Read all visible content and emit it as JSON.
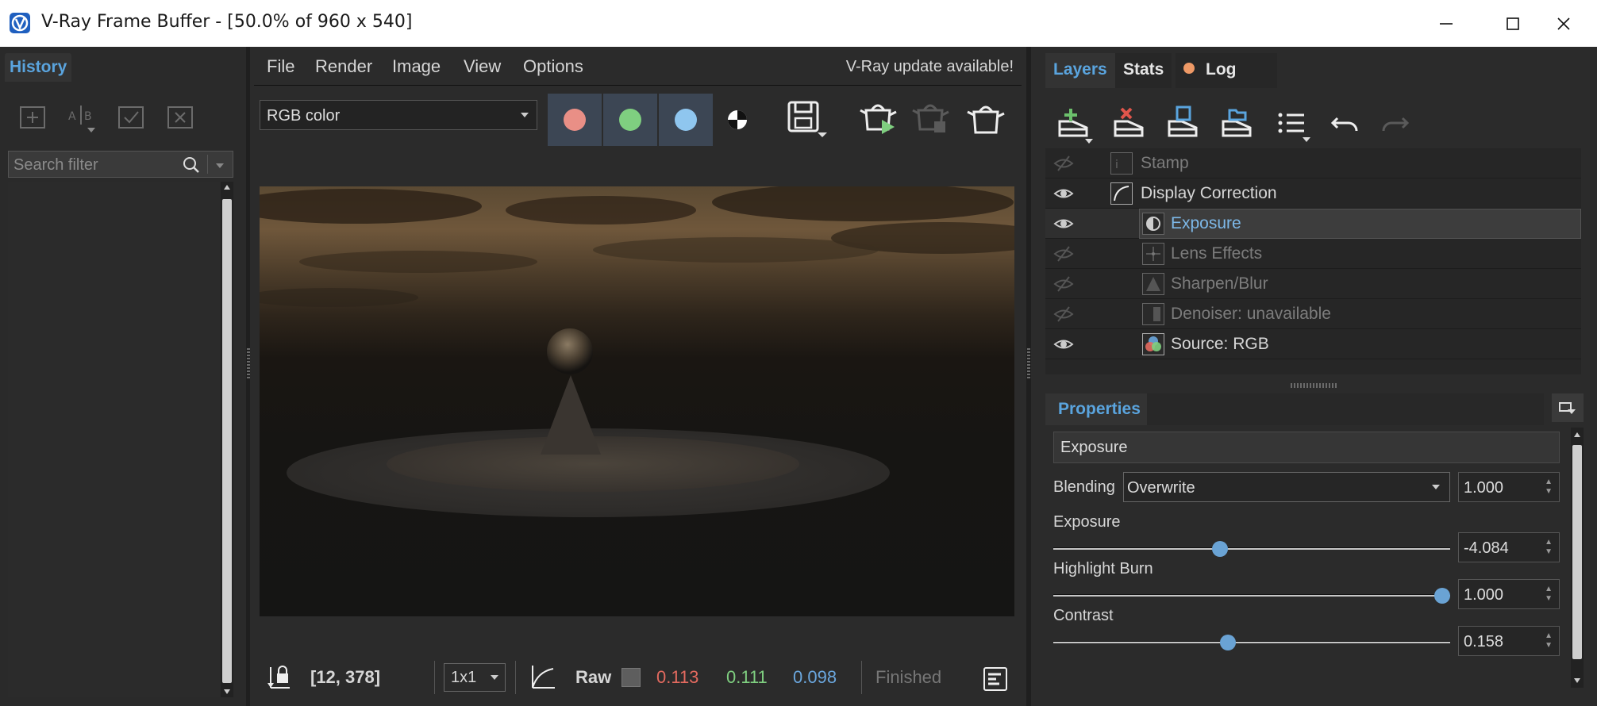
{
  "window": {
    "title": "V-Ray Frame Buffer - [50.0% of 960 x 540]",
    "controls": [
      "minimize",
      "maximize",
      "close"
    ]
  },
  "history": {
    "tab_label": "History",
    "tools": [
      "add-history-icon",
      "ab-compare-icon",
      "apply-icon",
      "remove-icon"
    ],
    "search": {
      "placeholder": "Search filter",
      "value": ""
    }
  },
  "menu": {
    "items": [
      "File",
      "Render",
      "Image",
      "View",
      "Options"
    ],
    "update_notice": "V-Ray update available!"
  },
  "toolbar": {
    "channel": "RGB color",
    "channel_buttons": [
      {
        "name": "red-channel",
        "color": "#e98f86"
      },
      {
        "name": "green-channel",
        "color": "#7fcf80"
      },
      {
        "name": "blue-channel",
        "color": "#8fc6ef"
      }
    ]
  },
  "status": {
    "coords": "[12, 378]",
    "zoom": "1x1",
    "mode": "Raw",
    "r": "0.113",
    "g": "0.111",
    "b": "0.098",
    "state": "Finished",
    "colors": {
      "r": "#e36a5f",
      "g": "#7fcf80",
      "b": "#6aa6dd"
    }
  },
  "right_tabs": {
    "layers": "Layers",
    "stats": "Stats",
    "log": "Log"
  },
  "layers": [
    {
      "name": "Stamp",
      "visible": false,
      "indent": 0,
      "icon": "stamp-icon"
    },
    {
      "name": "Display Correction",
      "visible": true,
      "indent": 0,
      "icon": "curve-icon"
    },
    {
      "name": "Exposure",
      "visible": true,
      "indent": 1,
      "icon": "exposure-icon",
      "selected": true
    },
    {
      "name": "Lens Effects",
      "visible": false,
      "indent": 1,
      "icon": "lens-effects-icon"
    },
    {
      "name": "Sharpen/Blur",
      "visible": false,
      "indent": 1,
      "icon": "sharpen-icon"
    },
    {
      "name": "Denoiser: unavailable",
      "visible": false,
      "indent": 1,
      "icon": "denoiser-icon"
    },
    {
      "name": "Source: RGB",
      "visible": true,
      "indent": 1,
      "icon": "rgb-source-icon"
    }
  ],
  "properties": {
    "tab_label": "Properties",
    "name": "Exposure",
    "blending_label": "Blending",
    "blending_mode": "Overwrite",
    "blending_value": "1.000",
    "params": [
      {
        "label": "Exposure",
        "value": "-4.084",
        "level": 0.42
      },
      {
        "label": "Highlight Burn",
        "value": "1.000",
        "level": 1.0
      },
      {
        "label": "Contrast",
        "value": "0.158",
        "level": 0.44
      }
    ]
  }
}
